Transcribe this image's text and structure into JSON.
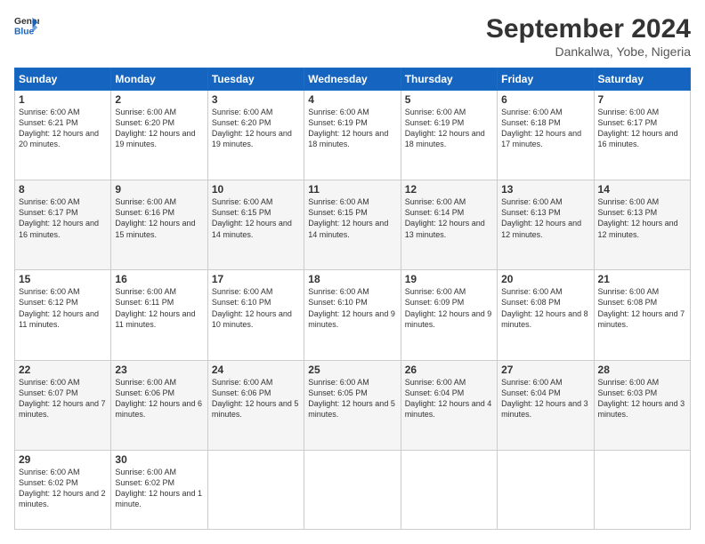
{
  "header": {
    "logo_line1": "General",
    "logo_line2": "Blue",
    "month_year": "September 2024",
    "location": "Dankalwa, Yobe, Nigeria"
  },
  "days_of_week": [
    "Sunday",
    "Monday",
    "Tuesday",
    "Wednesday",
    "Thursday",
    "Friday",
    "Saturday"
  ],
  "weeks": [
    [
      {
        "day": "1",
        "sunrise": "6:00 AM",
        "sunset": "6:21 PM",
        "daylight": "12 hours and 20 minutes."
      },
      {
        "day": "2",
        "sunrise": "6:00 AM",
        "sunset": "6:20 PM",
        "daylight": "12 hours and 19 minutes."
      },
      {
        "day": "3",
        "sunrise": "6:00 AM",
        "sunset": "6:20 PM",
        "daylight": "12 hours and 19 minutes."
      },
      {
        "day": "4",
        "sunrise": "6:00 AM",
        "sunset": "6:19 PM",
        "daylight": "12 hours and 18 minutes."
      },
      {
        "day": "5",
        "sunrise": "6:00 AM",
        "sunset": "6:19 PM",
        "daylight": "12 hours and 18 minutes."
      },
      {
        "day": "6",
        "sunrise": "6:00 AM",
        "sunset": "6:18 PM",
        "daylight": "12 hours and 17 minutes."
      },
      {
        "day": "7",
        "sunrise": "6:00 AM",
        "sunset": "6:17 PM",
        "daylight": "12 hours and 16 minutes."
      }
    ],
    [
      {
        "day": "8",
        "sunrise": "6:00 AM",
        "sunset": "6:17 PM",
        "daylight": "12 hours and 16 minutes."
      },
      {
        "day": "9",
        "sunrise": "6:00 AM",
        "sunset": "6:16 PM",
        "daylight": "12 hours and 15 minutes."
      },
      {
        "day": "10",
        "sunrise": "6:00 AM",
        "sunset": "6:15 PM",
        "daylight": "12 hours and 14 minutes."
      },
      {
        "day": "11",
        "sunrise": "6:00 AM",
        "sunset": "6:15 PM",
        "daylight": "12 hours and 14 minutes."
      },
      {
        "day": "12",
        "sunrise": "6:00 AM",
        "sunset": "6:14 PM",
        "daylight": "12 hours and 13 minutes."
      },
      {
        "day": "13",
        "sunrise": "6:00 AM",
        "sunset": "6:13 PM",
        "daylight": "12 hours and 12 minutes."
      },
      {
        "day": "14",
        "sunrise": "6:00 AM",
        "sunset": "6:13 PM",
        "daylight": "12 hours and 12 minutes."
      }
    ],
    [
      {
        "day": "15",
        "sunrise": "6:00 AM",
        "sunset": "6:12 PM",
        "daylight": "12 hours and 11 minutes."
      },
      {
        "day": "16",
        "sunrise": "6:00 AM",
        "sunset": "6:11 PM",
        "daylight": "12 hours and 11 minutes."
      },
      {
        "day": "17",
        "sunrise": "6:00 AM",
        "sunset": "6:10 PM",
        "daylight": "12 hours and 10 minutes."
      },
      {
        "day": "18",
        "sunrise": "6:00 AM",
        "sunset": "6:10 PM",
        "daylight": "12 hours and 9 minutes."
      },
      {
        "day": "19",
        "sunrise": "6:00 AM",
        "sunset": "6:09 PM",
        "daylight": "12 hours and 9 minutes."
      },
      {
        "day": "20",
        "sunrise": "6:00 AM",
        "sunset": "6:08 PM",
        "daylight": "12 hours and 8 minutes."
      },
      {
        "day": "21",
        "sunrise": "6:00 AM",
        "sunset": "6:08 PM",
        "daylight": "12 hours and 7 minutes."
      }
    ],
    [
      {
        "day": "22",
        "sunrise": "6:00 AM",
        "sunset": "6:07 PM",
        "daylight": "12 hours and 7 minutes."
      },
      {
        "day": "23",
        "sunrise": "6:00 AM",
        "sunset": "6:06 PM",
        "daylight": "12 hours and 6 minutes."
      },
      {
        "day": "24",
        "sunrise": "6:00 AM",
        "sunset": "6:06 PM",
        "daylight": "12 hours and 5 minutes."
      },
      {
        "day": "25",
        "sunrise": "6:00 AM",
        "sunset": "6:05 PM",
        "daylight": "12 hours and 5 minutes."
      },
      {
        "day": "26",
        "sunrise": "6:00 AM",
        "sunset": "6:04 PM",
        "daylight": "12 hours and 4 minutes."
      },
      {
        "day": "27",
        "sunrise": "6:00 AM",
        "sunset": "6:04 PM",
        "daylight": "12 hours and 3 minutes."
      },
      {
        "day": "28",
        "sunrise": "6:00 AM",
        "sunset": "6:03 PM",
        "daylight": "12 hours and 3 minutes."
      }
    ],
    [
      {
        "day": "29",
        "sunrise": "6:00 AM",
        "sunset": "6:02 PM",
        "daylight": "12 hours and 2 minutes."
      },
      {
        "day": "30",
        "sunrise": "6:00 AM",
        "sunset": "6:02 PM",
        "daylight": "12 hours and 1 minute."
      },
      null,
      null,
      null,
      null,
      null
    ]
  ]
}
